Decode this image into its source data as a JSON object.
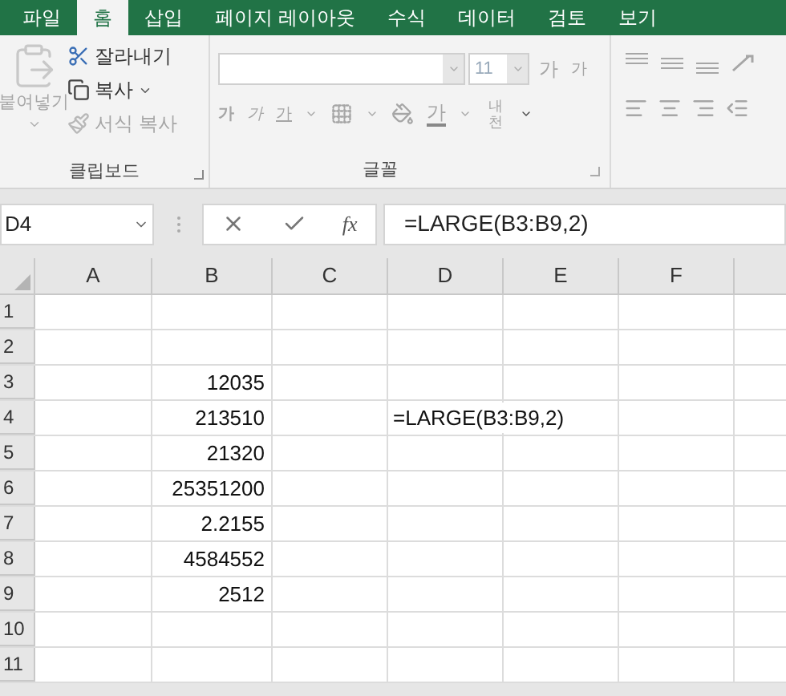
{
  "ribbon_tabs": [
    {
      "label": "파일",
      "selected": false
    },
    {
      "label": "홈",
      "selected": true
    },
    {
      "label": "삽입",
      "selected": false
    },
    {
      "label": "페이지 레이아웃",
      "selected": false
    },
    {
      "label": "수식",
      "selected": false
    },
    {
      "label": "데이터",
      "selected": false
    },
    {
      "label": "검토",
      "selected": false
    },
    {
      "label": "보기",
      "selected": false
    }
  ],
  "clipboard": {
    "paste": "붙여넣기",
    "cut": "잘라내기",
    "copy": "복사",
    "format_painter": "서식 복사",
    "group_label": "클립보드"
  },
  "font": {
    "size": "11",
    "grow": "가",
    "shrink": "가",
    "bold": "가",
    "italic": "가",
    "underline": "가",
    "font_color": "가",
    "phonetic": "내천",
    "group_label": "글꼴"
  },
  "formula_bar": {
    "name_box": "D4",
    "fx": "fx",
    "formula": "=LARGE(B3:B9,2)"
  },
  "sheet": {
    "columns": [
      "A",
      "B",
      "C",
      "D",
      "E",
      "F"
    ],
    "rows": [
      {
        "header": "1",
        "cells": []
      },
      {
        "header": "2",
        "cells": []
      },
      {
        "header": "3",
        "cells": [
          "",
          "12035"
        ]
      },
      {
        "header": "4",
        "cells": [
          "",
          "213510",
          "",
          "=LARGE(B3:B9,2)"
        ]
      },
      {
        "header": "5",
        "cells": [
          "",
          "21320"
        ]
      },
      {
        "header": "6",
        "cells": [
          "",
          "25351200"
        ]
      },
      {
        "header": "7",
        "cells": [
          "",
          "2.2155"
        ]
      },
      {
        "header": "8",
        "cells": [
          "",
          "4584552"
        ]
      },
      {
        "header": "9",
        "cells": [
          "",
          "2512"
        ]
      },
      {
        "header": "10",
        "cells": []
      },
      {
        "header": "11",
        "cells": []
      }
    ]
  }
}
